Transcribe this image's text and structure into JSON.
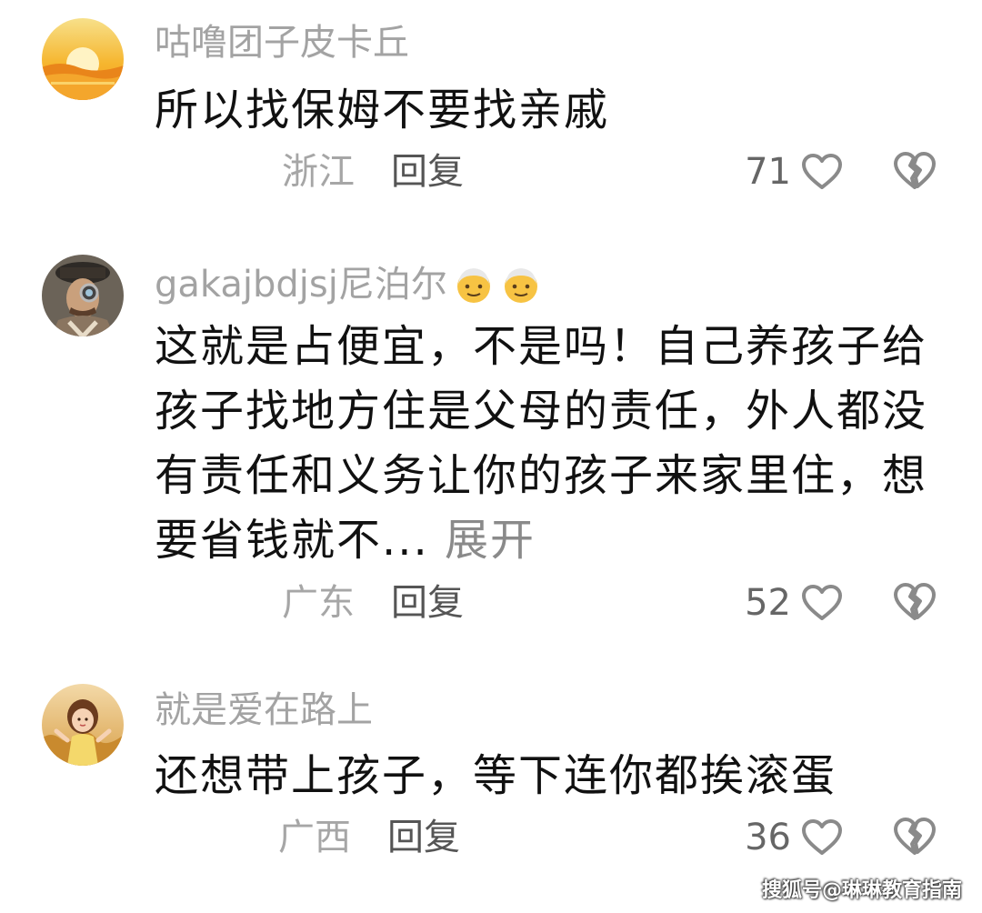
{
  "comments": [
    {
      "username": "咕噜团子皮卡丘",
      "text": "所以找保姆不要找亲戚",
      "location": "浙江",
      "reply_label": "回复",
      "likes": "71",
      "avatar": "sunset-avatar"
    },
    {
      "username": "gakajbdjsj尼泊尔",
      "username_emoji": "older-man-emoji",
      "text": "这就是占便宜，不是吗！自己养孩子给孩子找地方住是父母的责任，外人都没有责任和义务让你的孩子来家里住，想要省钱就不...",
      "expand_label": "展开",
      "location": "广东",
      "reply_label": "回复",
      "likes": "52",
      "avatar": "steampunk-man-avatar"
    },
    {
      "username": "就是爱在路上",
      "text": "还想带上孩子，等下连你都挨滚蛋",
      "location": "广西",
      "reply_label": "回复",
      "likes": "36",
      "avatar": "girl-in-field-avatar"
    }
  ],
  "watermark": "搜狐号@琳琳教育指南",
  "colors": {
    "username": "#a3a3a3",
    "text": "#111111",
    "location": "#a6a6a6",
    "reply": "#555555",
    "icon": "#8a8a8a"
  }
}
